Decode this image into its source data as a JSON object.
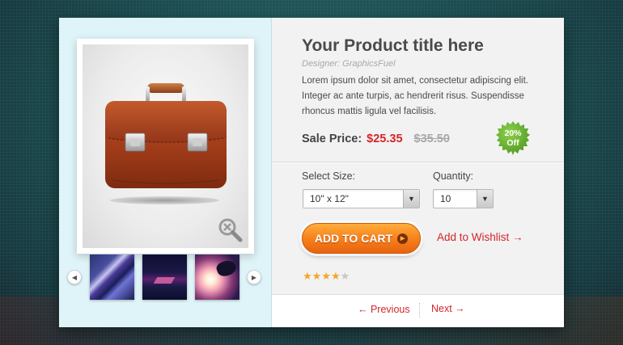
{
  "product": {
    "title": "Your Product title here",
    "designer": "Designer: GraphicsFuel",
    "description": "Lorem ipsum dolor sit amet, consectetur adipiscing elit. Integer ac ante turpis, ac hendrerit risus. Suspendisse rhoncus mattis ligula vel facilisis."
  },
  "price": {
    "label": "Sale Price:",
    "sale": "$25.35",
    "original": "$35.50"
  },
  "badge": {
    "line1": "20%",
    "line2": "Off",
    "color": "#6bb536"
  },
  "options": {
    "size_label": "Select Size:",
    "size_value": "10\" x 12\"",
    "quantity_label": "Quantity:",
    "quantity_value": "10"
  },
  "actions": {
    "add_to_cart": "ADD TO CART",
    "wishlist": "Add to Wishlist →"
  },
  "rating": {
    "stars_filled": 4,
    "stars_total": 5
  },
  "pagination": {
    "previous": "← Previous",
    "next": "Next →"
  },
  "gallery": {
    "prev_icon": "chevron-left-icon",
    "next_icon": "chevron-right-icon",
    "zoom_icon": "zoom-out-icon",
    "thumbnail_count": 3
  },
  "colors": {
    "accent_red": "#d3262a",
    "cart_orange": "#f7811c",
    "star_gold": "#f5a623"
  }
}
